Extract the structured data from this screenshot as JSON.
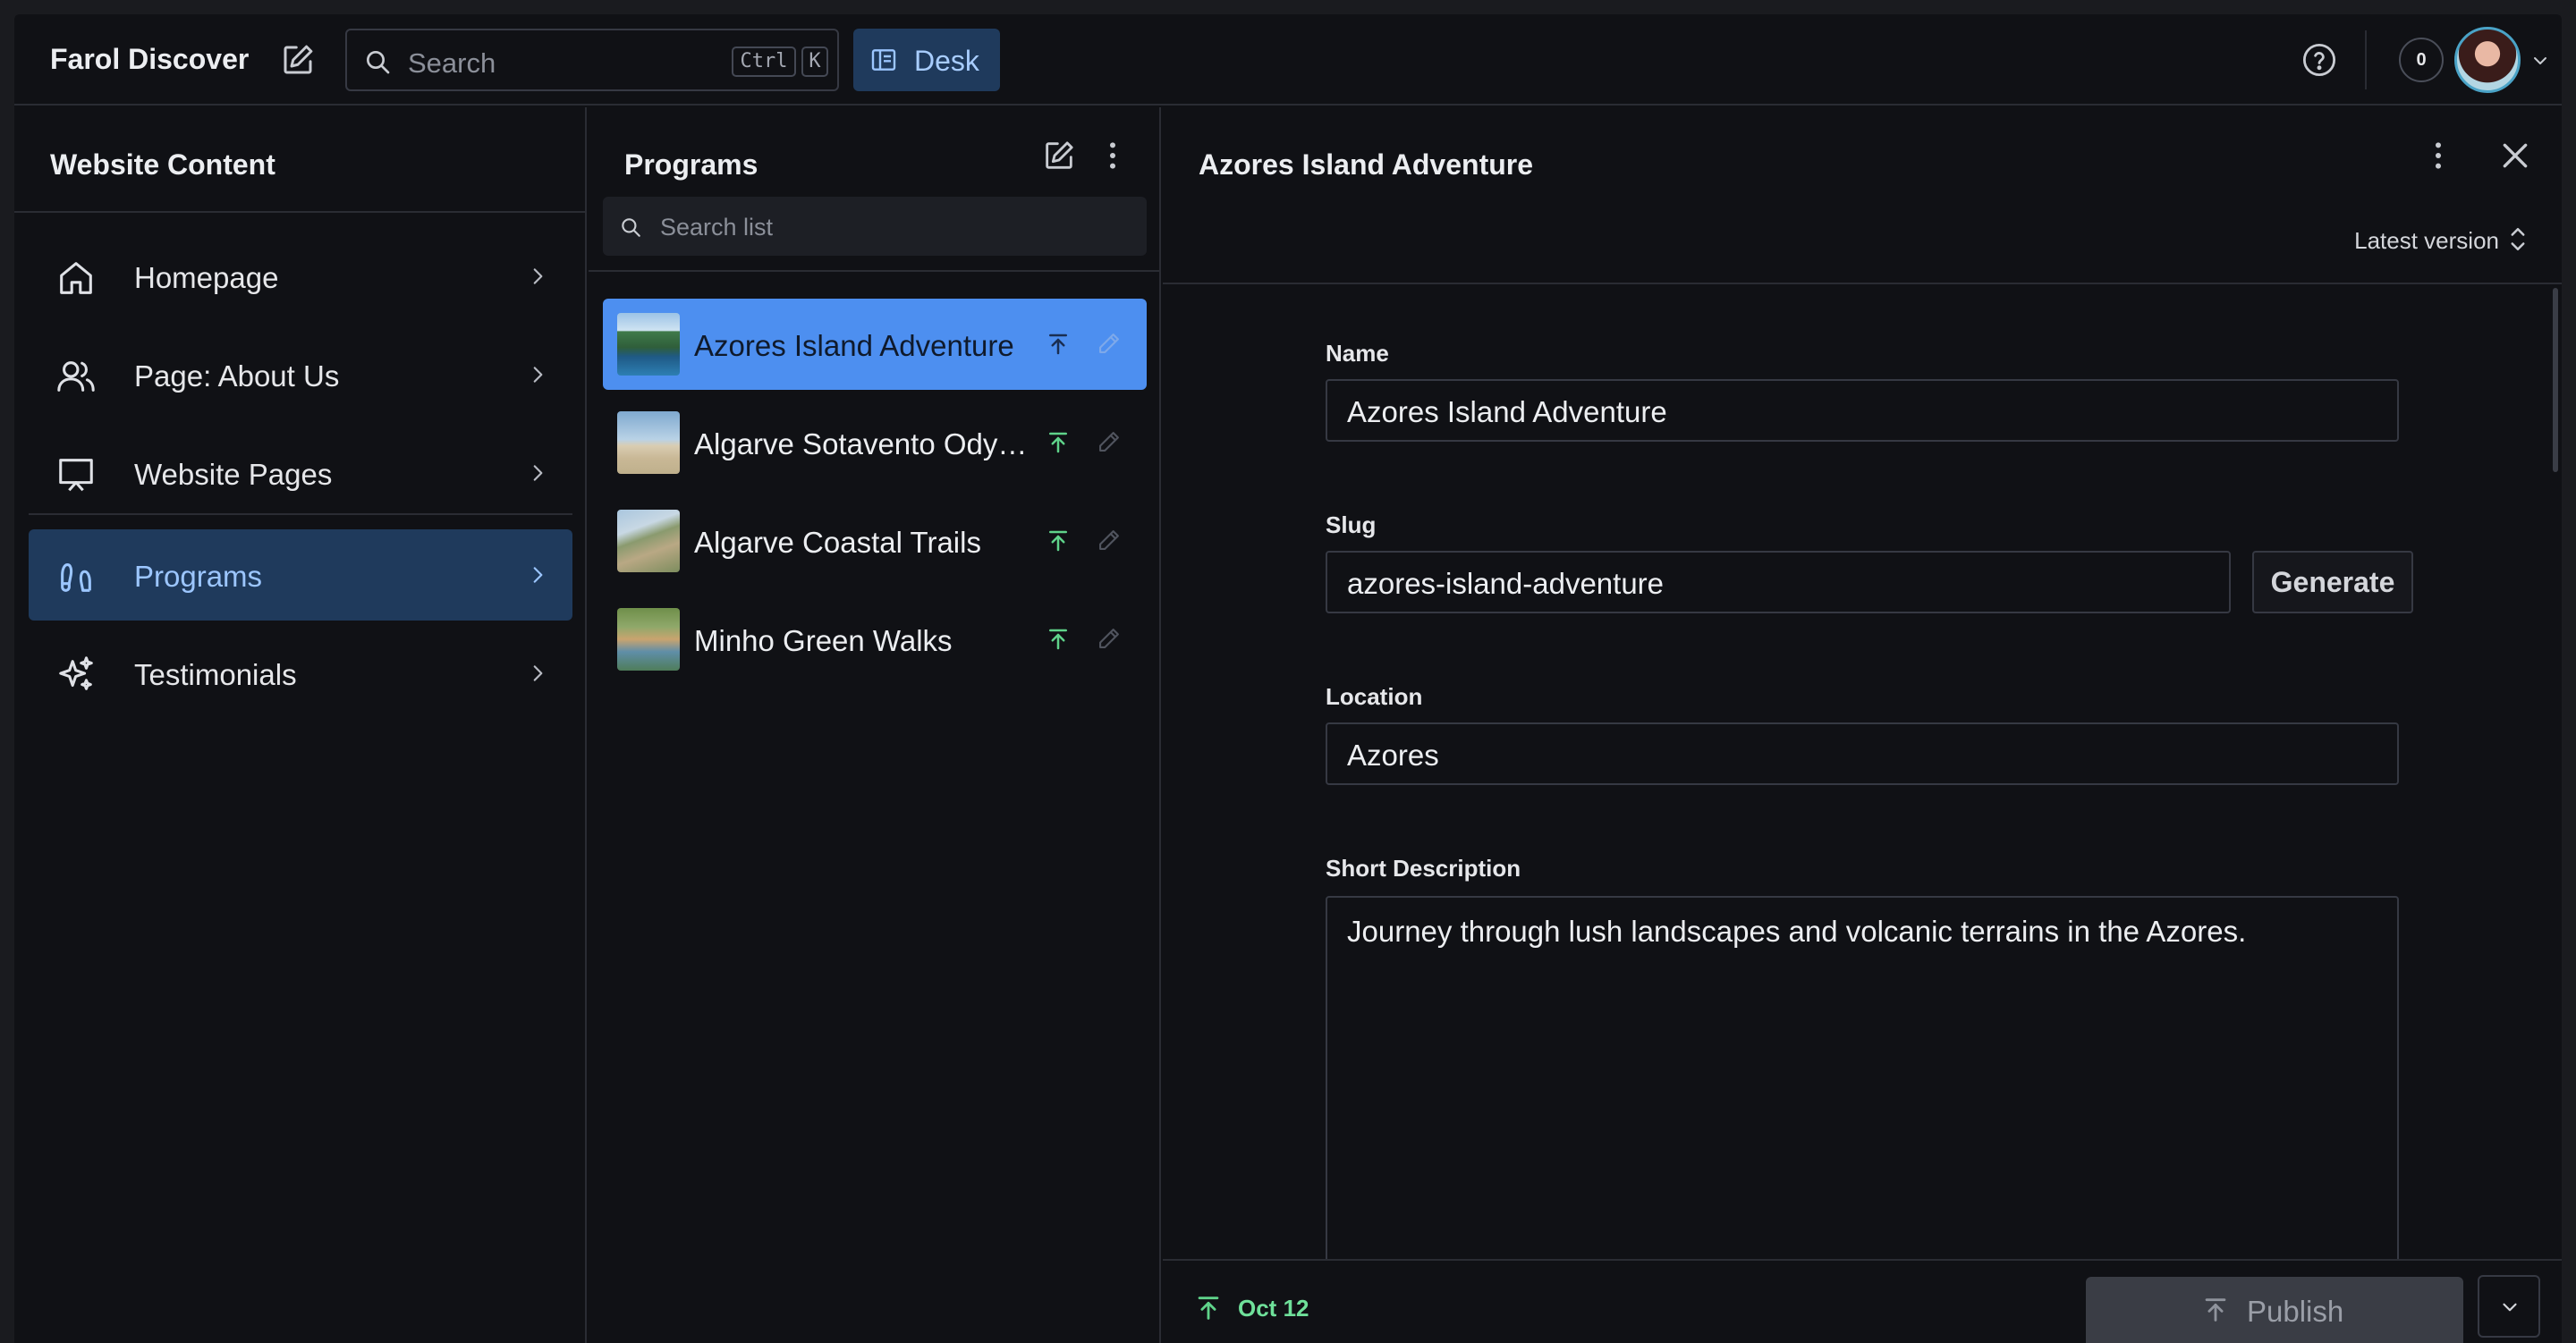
{
  "app": {
    "brand": "Farol Discover",
    "search_placeholder": "Search",
    "shortcut_ctrl": "Ctrl",
    "shortcut_key": "K",
    "desk_label": "Desk",
    "notification_count": "0"
  },
  "structure": {
    "title": "Website Content",
    "items": [
      {
        "label": "Homepage",
        "icon": "home-icon"
      },
      {
        "label": "Page: About Us",
        "icon": "users-icon"
      },
      {
        "label": "Website Pages",
        "icon": "presentation-icon"
      },
      {
        "label": "Programs",
        "icon": "footprints-icon",
        "active": true
      },
      {
        "label": "Testimonials",
        "icon": "sparkles-icon"
      }
    ]
  },
  "programs": {
    "title": "Programs",
    "search_placeholder": "Search list",
    "items": [
      {
        "title": "Azores Island Adventure",
        "active": true
      },
      {
        "title": "Algarve Sotavento Odyssey"
      },
      {
        "title": "Algarve Coastal Trails"
      },
      {
        "title": "Minho Green Walks"
      }
    ]
  },
  "document": {
    "title": "Azores Island Adventure",
    "version": "Latest version",
    "fields": {
      "name_label": "Name",
      "name_value": "Azores Island Adventure",
      "slug_label": "Slug",
      "slug_value": "azores-island-adventure",
      "generate_label": "Generate",
      "location_label": "Location",
      "location_value": "Azores",
      "short_description_label": "Short Description",
      "short_description_value": "Journey through lush landscapes and volcanic terrains in the Azores."
    },
    "footer": {
      "published_date": "Oct 12",
      "publish_label": "Publish"
    }
  },
  "colors": {
    "accent": "#4d8ff0",
    "active_nav_bg": "#1f3a5c",
    "published_green": "#5fd38a"
  }
}
